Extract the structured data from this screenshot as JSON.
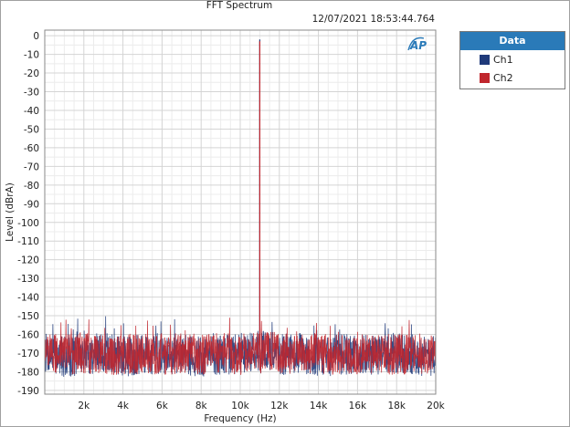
{
  "window": {
    "title": "FFT Spectrum",
    "timestamp": "12/07/2021 18:53:44.764"
  },
  "legend": {
    "header": "Data",
    "items": [
      {
        "label": "Ch1",
        "color": "#1f3a7a"
      },
      {
        "label": "Ch2",
        "color": "#c0262d"
      }
    ]
  },
  "logo_icon": "ap-logo-icon",
  "chart_data": {
    "type": "line",
    "title": "FFT Spectrum",
    "xlabel": "Frequency (Hz)",
    "ylabel": "Level (dBrA)",
    "xlim": [
      0,
      20000
    ],
    "ylim": [
      -192,
      3
    ],
    "grid": true,
    "x_ticks": [
      2000,
      4000,
      6000,
      8000,
      10000,
      12000,
      14000,
      16000,
      18000,
      20000
    ],
    "x_tick_labels": [
      "2k",
      "4k",
      "6k",
      "8k",
      "10k",
      "12k",
      "14k",
      "16k",
      "18k",
      "20k"
    ],
    "y_ticks": [
      0,
      -10,
      -20,
      -30,
      -40,
      -50,
      -60,
      -70,
      -80,
      -90,
      -100,
      -110,
      -120,
      -130,
      -140,
      -150,
      -160,
      -170,
      -180,
      -190
    ],
    "y_tick_labels": [
      "0",
      "-10",
      "-20",
      "-30",
      "-40",
      "-50",
      "-60",
      "-70",
      "-80",
      "-90",
      "-100",
      "-110",
      "-120",
      "-130",
      "-140",
      "-150",
      "-160",
      "-170",
      "-180",
      "-190"
    ],
    "legend_position": "outside-right",
    "series": [
      {
        "name": "Ch1",
        "color": "#1f3a7a",
        "x": [
          20,
          1000,
          2000,
          3000,
          4000,
          5000,
          6000,
          7000,
          8000,
          9000,
          10000,
          10900,
          11000,
          11100,
          12000,
          13000,
          14000,
          15000,
          16000,
          17000,
          18000,
          19000,
          20000
        ],
        "y": [
          -170,
          -172,
          -171,
          -170,
          -172,
          -171,
          -170,
          -171,
          -172,
          -171,
          -170,
          -168,
          -2,
          -168,
          -171,
          -170,
          -172,
          -171,
          -170,
          -171,
          -170,
          -171,
          -172
        ]
      },
      {
        "name": "Ch2",
        "color": "#c0262d",
        "x": [
          20,
          1000,
          2000,
          3000,
          4000,
          5000,
          6000,
          7000,
          8000,
          9000,
          10000,
          10900,
          11000,
          11100,
          12000,
          13000,
          14000,
          15000,
          16000,
          17000,
          18000,
          19000,
          20000
        ],
        "y": [
          -170,
          -171,
          -170,
          -171,
          -171,
          -170,
          -171,
          -170,
          -171,
          -170,
          -171,
          -168,
          -3,
          -168,
          -170,
          -171,
          -170,
          -171,
          -171,
          -170,
          -171,
          -170,
          -171
        ]
      }
    ]
  }
}
